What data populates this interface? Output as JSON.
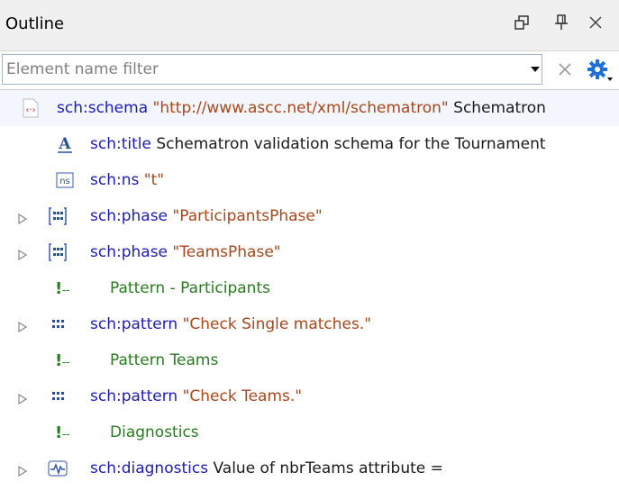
{
  "panel": {
    "title": "Outline"
  },
  "filter": {
    "placeholder": "Element name filter",
    "value": ""
  },
  "tree": {
    "rows": [
      {
        "name": "sch:schema",
        "value": "\"http://www.ascc.net/xml/schematron\"",
        "text": "Schematron",
        "icon": "schema-icon"
      },
      {
        "name": "sch:title",
        "text": "Schematron validation schema for the Tournament",
        "icon": "text-icon"
      },
      {
        "name": "sch:ns",
        "value": "\"t\"",
        "icon": "namespace-icon"
      },
      {
        "name": "sch:phase",
        "value": "\"ParticipantsPhase\"",
        "icon": "phase-icon"
      },
      {
        "name": "sch:phase",
        "value": "\"TeamsPhase\"",
        "icon": "phase-icon"
      },
      {
        "comment": "Pattern - Participants",
        "icon": "comment-icon"
      },
      {
        "name": "sch:pattern",
        "value": "\"Check Single matches.\"",
        "icon": "pattern-icon"
      },
      {
        "comment": "Pattern Teams",
        "icon": "comment-icon"
      },
      {
        "name": "sch:pattern",
        "value": "\"Check Teams.\"",
        "icon": "pattern-icon"
      },
      {
        "comment": "Diagnostics",
        "icon": "comment-icon"
      },
      {
        "name": "sch:diagnostics",
        "text": "Value of nbrTeams attribute =",
        "icon": "diagnostics-icon"
      }
    ]
  },
  "colors": {
    "element": "#1c1cb4",
    "value": "#a8461c",
    "comment": "#2a7a22",
    "accent": "#1f6fd6"
  }
}
